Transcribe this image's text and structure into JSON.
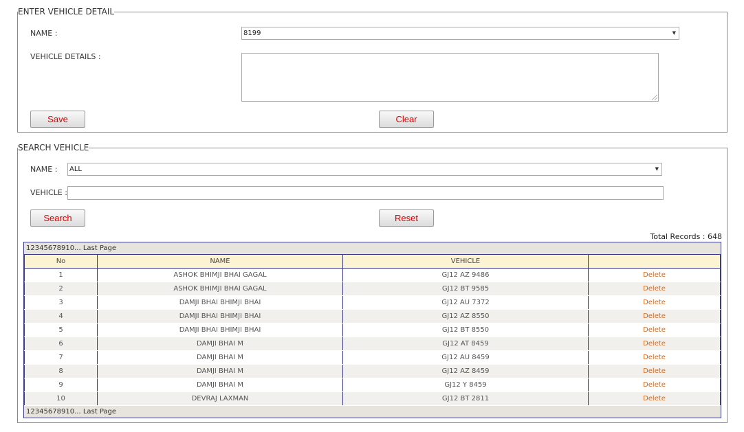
{
  "entry": {
    "legend": "ENTER VEHICLE DETAIL",
    "name_label": "NAME :",
    "name_value": "8199",
    "details_label": "VEHICLE DETAILS :",
    "save_label": "Save",
    "clear_label": "Clear"
  },
  "search": {
    "legend": "SEARCH VEHICLE",
    "name_label": "NAME :",
    "name_value": "ALL",
    "vehicle_label": "VEHICLE :",
    "search_label": "Search",
    "reset_label": "Reset"
  },
  "total_records": "Total Records : 648",
  "pager": {
    "pages": [
      "1",
      "2",
      "3",
      "4",
      "5",
      "6",
      "7",
      "8",
      "9",
      "10",
      "..."
    ],
    "last": "Last Page"
  },
  "table": {
    "headers": [
      "No",
      "NAME",
      "VEHICLE",
      ""
    ],
    "rows": [
      {
        "no": "1",
        "name": "ASHOK BHIMJI BHAI GAGAL",
        "vehicle": "GJ12 AZ 9486",
        "action": "Delete"
      },
      {
        "no": "2",
        "name": "ASHOK BHIMJI BHAI GAGAL",
        "vehicle": "GJ12 BT 9585",
        "action": "Delete"
      },
      {
        "no": "3",
        "name": "DAMJI BHAI BHIMJI BHAI",
        "vehicle": "GJ12 AU 7372",
        "action": "Delete"
      },
      {
        "no": "4",
        "name": "DAMJI BHAI BHIMJI BHAI",
        "vehicle": "GJ12 AZ 8550",
        "action": "Delete"
      },
      {
        "no": "5",
        "name": "DAMJI BHAI BHIMJI BHAI",
        "vehicle": "GJ12 BT 8550",
        "action": "Delete"
      },
      {
        "no": "6",
        "name": "DAMJI BHAI M",
        "vehicle": "GJ12 AT 8459",
        "action": "Delete"
      },
      {
        "no": "7",
        "name": "DAMJI BHAI M",
        "vehicle": "GJ12 AU 8459",
        "action": "Delete"
      },
      {
        "no": "8",
        "name": "DAMJI BHAI M",
        "vehicle": "GJ12 AZ 8459",
        "action": "Delete"
      },
      {
        "no": "9",
        "name": "DAMJI BHAI M",
        "vehicle": "GJ12 Y 8459",
        "action": "Delete"
      },
      {
        "no": "10",
        "name": "DEVRAJ LAXMAN",
        "vehicle": "GJ12 BT 2811",
        "action": "Delete"
      }
    ]
  },
  "colors": {
    "button_text": "#e00000",
    "delete_link": "#d2691e",
    "header_bg": "#fbf3d2",
    "grid_border": "#3a3a8a"
  }
}
